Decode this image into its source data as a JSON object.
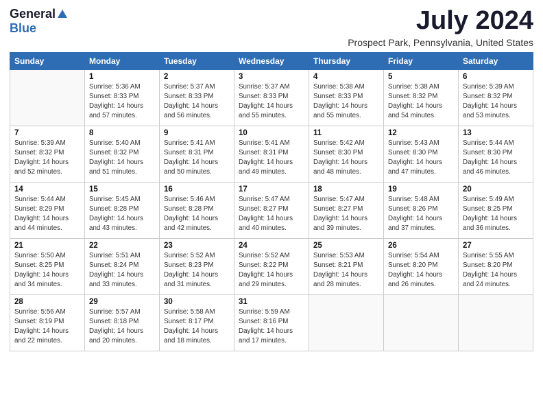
{
  "logo": {
    "general": "General",
    "blue": "Blue"
  },
  "header": {
    "month": "July 2024",
    "location": "Prospect Park, Pennsylvania, United States"
  },
  "weekdays": [
    "Sunday",
    "Monday",
    "Tuesday",
    "Wednesday",
    "Thursday",
    "Friday",
    "Saturday"
  ],
  "weeks": [
    [
      {
        "day": "",
        "sunrise": "",
        "sunset": "",
        "daylight": ""
      },
      {
        "day": "1",
        "sunrise": "Sunrise: 5:36 AM",
        "sunset": "Sunset: 8:33 PM",
        "daylight": "Daylight: 14 hours and 57 minutes."
      },
      {
        "day": "2",
        "sunrise": "Sunrise: 5:37 AM",
        "sunset": "Sunset: 8:33 PM",
        "daylight": "Daylight: 14 hours and 56 minutes."
      },
      {
        "day": "3",
        "sunrise": "Sunrise: 5:37 AM",
        "sunset": "Sunset: 8:33 PM",
        "daylight": "Daylight: 14 hours and 55 minutes."
      },
      {
        "day": "4",
        "sunrise": "Sunrise: 5:38 AM",
        "sunset": "Sunset: 8:33 PM",
        "daylight": "Daylight: 14 hours and 55 minutes."
      },
      {
        "day": "5",
        "sunrise": "Sunrise: 5:38 AM",
        "sunset": "Sunset: 8:32 PM",
        "daylight": "Daylight: 14 hours and 54 minutes."
      },
      {
        "day": "6",
        "sunrise": "Sunrise: 5:39 AM",
        "sunset": "Sunset: 8:32 PM",
        "daylight": "Daylight: 14 hours and 53 minutes."
      }
    ],
    [
      {
        "day": "7",
        "sunrise": "Sunrise: 5:39 AM",
        "sunset": "Sunset: 8:32 PM",
        "daylight": "Daylight: 14 hours and 52 minutes."
      },
      {
        "day": "8",
        "sunrise": "Sunrise: 5:40 AM",
        "sunset": "Sunset: 8:32 PM",
        "daylight": "Daylight: 14 hours and 51 minutes."
      },
      {
        "day": "9",
        "sunrise": "Sunrise: 5:41 AM",
        "sunset": "Sunset: 8:31 PM",
        "daylight": "Daylight: 14 hours and 50 minutes."
      },
      {
        "day": "10",
        "sunrise": "Sunrise: 5:41 AM",
        "sunset": "Sunset: 8:31 PM",
        "daylight": "Daylight: 14 hours and 49 minutes."
      },
      {
        "day": "11",
        "sunrise": "Sunrise: 5:42 AM",
        "sunset": "Sunset: 8:30 PM",
        "daylight": "Daylight: 14 hours and 48 minutes."
      },
      {
        "day": "12",
        "sunrise": "Sunrise: 5:43 AM",
        "sunset": "Sunset: 8:30 PM",
        "daylight": "Daylight: 14 hours and 47 minutes."
      },
      {
        "day": "13",
        "sunrise": "Sunrise: 5:44 AM",
        "sunset": "Sunset: 8:30 PM",
        "daylight": "Daylight: 14 hours and 46 minutes."
      }
    ],
    [
      {
        "day": "14",
        "sunrise": "Sunrise: 5:44 AM",
        "sunset": "Sunset: 8:29 PM",
        "daylight": "Daylight: 14 hours and 44 minutes."
      },
      {
        "day": "15",
        "sunrise": "Sunrise: 5:45 AM",
        "sunset": "Sunset: 8:28 PM",
        "daylight": "Daylight: 14 hours and 43 minutes."
      },
      {
        "day": "16",
        "sunrise": "Sunrise: 5:46 AM",
        "sunset": "Sunset: 8:28 PM",
        "daylight": "Daylight: 14 hours and 42 minutes."
      },
      {
        "day": "17",
        "sunrise": "Sunrise: 5:47 AM",
        "sunset": "Sunset: 8:27 PM",
        "daylight": "Daylight: 14 hours and 40 minutes."
      },
      {
        "day": "18",
        "sunrise": "Sunrise: 5:47 AM",
        "sunset": "Sunset: 8:27 PM",
        "daylight": "Daylight: 14 hours and 39 minutes."
      },
      {
        "day": "19",
        "sunrise": "Sunrise: 5:48 AM",
        "sunset": "Sunset: 8:26 PM",
        "daylight": "Daylight: 14 hours and 37 minutes."
      },
      {
        "day": "20",
        "sunrise": "Sunrise: 5:49 AM",
        "sunset": "Sunset: 8:25 PM",
        "daylight": "Daylight: 14 hours and 36 minutes."
      }
    ],
    [
      {
        "day": "21",
        "sunrise": "Sunrise: 5:50 AM",
        "sunset": "Sunset: 8:25 PM",
        "daylight": "Daylight: 14 hours and 34 minutes."
      },
      {
        "day": "22",
        "sunrise": "Sunrise: 5:51 AM",
        "sunset": "Sunset: 8:24 PM",
        "daylight": "Daylight: 14 hours and 33 minutes."
      },
      {
        "day": "23",
        "sunrise": "Sunrise: 5:52 AM",
        "sunset": "Sunset: 8:23 PM",
        "daylight": "Daylight: 14 hours and 31 minutes."
      },
      {
        "day": "24",
        "sunrise": "Sunrise: 5:52 AM",
        "sunset": "Sunset: 8:22 PM",
        "daylight": "Daylight: 14 hours and 29 minutes."
      },
      {
        "day": "25",
        "sunrise": "Sunrise: 5:53 AM",
        "sunset": "Sunset: 8:21 PM",
        "daylight": "Daylight: 14 hours and 28 minutes."
      },
      {
        "day": "26",
        "sunrise": "Sunrise: 5:54 AM",
        "sunset": "Sunset: 8:20 PM",
        "daylight": "Daylight: 14 hours and 26 minutes."
      },
      {
        "day": "27",
        "sunrise": "Sunrise: 5:55 AM",
        "sunset": "Sunset: 8:20 PM",
        "daylight": "Daylight: 14 hours and 24 minutes."
      }
    ],
    [
      {
        "day": "28",
        "sunrise": "Sunrise: 5:56 AM",
        "sunset": "Sunset: 8:19 PM",
        "daylight": "Daylight: 14 hours and 22 minutes."
      },
      {
        "day": "29",
        "sunrise": "Sunrise: 5:57 AM",
        "sunset": "Sunset: 8:18 PM",
        "daylight": "Daylight: 14 hours and 20 minutes."
      },
      {
        "day": "30",
        "sunrise": "Sunrise: 5:58 AM",
        "sunset": "Sunset: 8:17 PM",
        "daylight": "Daylight: 14 hours and 18 minutes."
      },
      {
        "day": "31",
        "sunrise": "Sunrise: 5:59 AM",
        "sunset": "Sunset: 8:16 PM",
        "daylight": "Daylight: 14 hours and 17 minutes."
      },
      {
        "day": "",
        "sunrise": "",
        "sunset": "",
        "daylight": ""
      },
      {
        "day": "",
        "sunrise": "",
        "sunset": "",
        "daylight": ""
      },
      {
        "day": "",
        "sunrise": "",
        "sunset": "",
        "daylight": ""
      }
    ]
  ]
}
